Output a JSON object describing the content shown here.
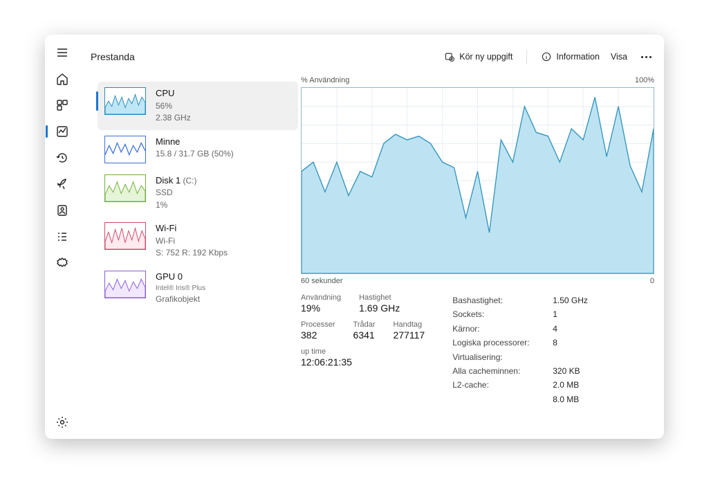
{
  "header": {
    "title": "Prestanda",
    "run_task": "Kör ny uppgift",
    "info": "Information",
    "view": "Visa"
  },
  "sidebar": {
    "items": [
      {
        "name": "CPU",
        "line1": "56%",
        "line2": "2.38 GHz",
        "color": "#7ec6e6",
        "stroke": "#2a8cb7"
      },
      {
        "name": "Minne",
        "line1": "15.8 / 31.7 GB (50%)",
        "line2": "",
        "color": "#dfe9ff",
        "stroke": "#3b6fd6"
      },
      {
        "name": "Disk 1",
        "extra": "(C:)",
        "line1": "SSD",
        "line2": "1%",
        "color": "#dff3cf",
        "stroke": "#6fae3a"
      },
      {
        "name": "Wi-Fi",
        "line1": "Wi-Fi",
        "line2": "S: 752 R: 192 Kbps",
        "color": "#ffe1e6",
        "stroke": "#cc4a6a"
      },
      {
        "name": "GPU 0",
        "tiny": "Intel®   Iris®   Plus",
        "line1": "Grafikobjekt",
        "color": "#ede1ff",
        "stroke": "#8a5cd6"
      }
    ]
  },
  "chart": {
    "y_label": "% Användning",
    "y_max_label": "100%",
    "x_left": "60 sekunder",
    "x_right": "0"
  },
  "stats": {
    "usage_lbl": "Användning",
    "usage_val": "19%",
    "speed_lbl": "Hastighet",
    "speed_val": "1.69 GHz",
    "proc_lbl": "Processer",
    "proc_val": "382",
    "thread_lbl": "Trådar",
    "thread_val": "6341",
    "handle_lbl": "Handtag",
    "handle_val": "277117",
    "uptime_lbl": "up time",
    "uptime_val": "12:06:21:35"
  },
  "specs": {
    "base_k": "Bashastighet:",
    "base_v": "1.50 GHz",
    "sockets_k": "Sockets:",
    "sockets_v": "1",
    "cores_k": "Kärnor:",
    "cores_v": "4",
    "lproc_k": "Logiska processorer:",
    "lproc_v": "8",
    "virt_k": "Virtualisering:",
    "virt_v": "",
    "cache_k": "Alla cacheminnen:",
    "cache_v": "320 KB",
    "l2_k": "L2-cache:",
    "l2_v": "2.0 MB",
    "l3_v": "8.0 MB"
  },
  "chart_data": {
    "type": "area",
    "title": "% Användning",
    "xlabel": "sekunder",
    "ylabel": "%",
    "ylim": [
      0,
      100
    ],
    "x": [
      60,
      58,
      56,
      54,
      52,
      50,
      48,
      46,
      44,
      42,
      40,
      38,
      36,
      34,
      32,
      30,
      28,
      26,
      24,
      22,
      20,
      18,
      16,
      14,
      12,
      10,
      8,
      6,
      4,
      2,
      0
    ],
    "values": [
      55,
      60,
      44,
      60,
      42,
      55,
      52,
      70,
      75,
      72,
      74,
      70,
      60,
      57,
      30,
      55,
      22,
      72,
      60,
      90,
      76,
      74,
      60,
      78,
      72,
      95,
      63,
      90,
      58,
      44,
      78
    ]
  }
}
